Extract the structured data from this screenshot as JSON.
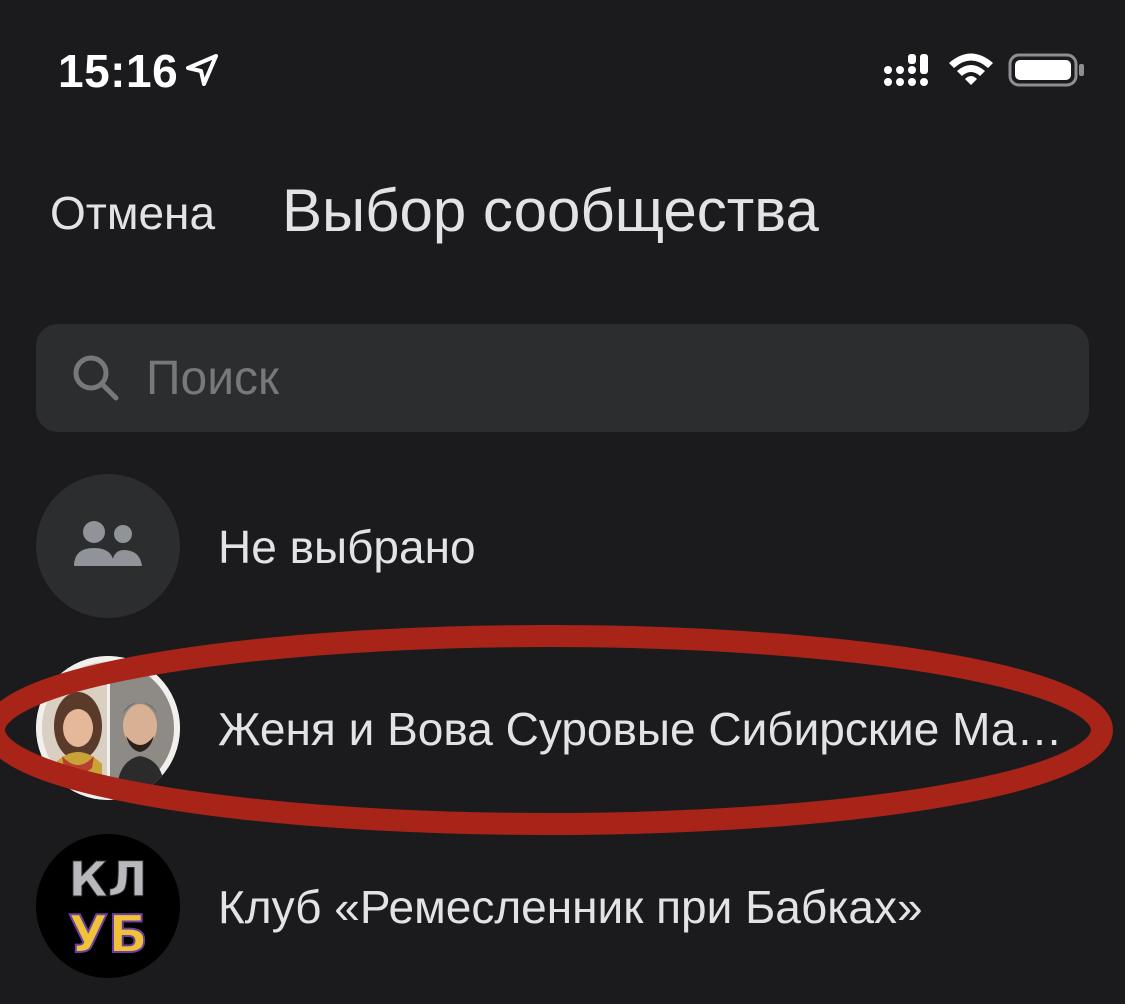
{
  "status_bar": {
    "time": "15:16",
    "icons": [
      "location-arrow-icon",
      "signal-icon",
      "wifi-icon",
      "battery-icon"
    ]
  },
  "nav": {
    "cancel_label": "Отмена",
    "title": "Выбор сообщества"
  },
  "search": {
    "placeholder": "Поиск",
    "value": ""
  },
  "communities": [
    {
      "label": "Не выбрано",
      "avatar": "group-icon"
    },
    {
      "label": "Женя и Вова Суровые Сибирские Мастера",
      "avatar": "community-photo-avatar"
    },
    {
      "label": "Клуб «Ремесленник при Бабках»",
      "avatar": "club-logo-avatar",
      "avatar_text": "КЛУБ"
    }
  ],
  "annotation": {
    "type": "red-ellipse-highlight",
    "color": "#a82418"
  },
  "colors": {
    "background": "#1b1b1d",
    "text": "#e1e3e6",
    "search_bg": "#2c2d2e",
    "placeholder": "#76787a",
    "highlight": "#a82418"
  }
}
